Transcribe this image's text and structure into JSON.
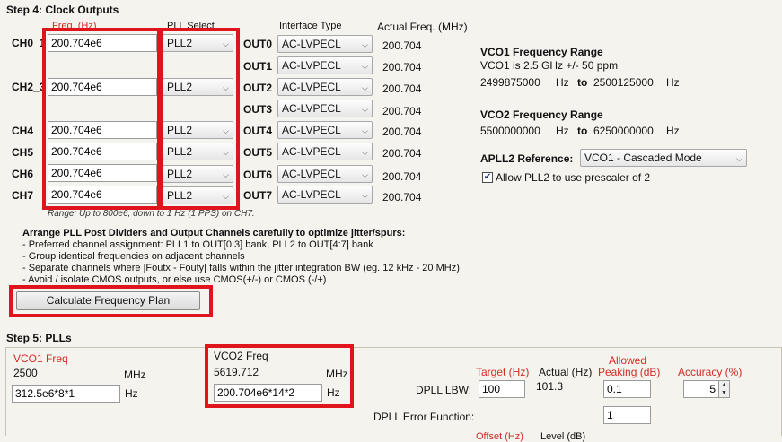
{
  "step4": {
    "title": "Step 4: Clock Outputs",
    "headers": {
      "freq": "Freq. (Hz)",
      "pll_select": "PLL Select",
      "interface_type": "Interface Type",
      "actual_freq": "Actual Freq. (MHz)"
    },
    "channels": [
      {
        "label": "CH0_1",
        "freq": "200.704e6",
        "pll": "PLL2"
      },
      {
        "label": "CH2_3",
        "freq": "200.704e6",
        "pll": "PLL2"
      },
      {
        "label": "CH4",
        "freq": "200.704e6",
        "pll": "PLL2"
      },
      {
        "label": "CH5",
        "freq": "200.704e6",
        "pll": "PLL2"
      },
      {
        "label": "CH6",
        "freq": "200.704e6",
        "pll": "PLL2"
      },
      {
        "label": "CH7",
        "freq": "200.704e6",
        "pll": "PLL2"
      }
    ],
    "outputs": [
      {
        "label": "OUT0",
        "interface": "AC-LVPECL",
        "actual": "200.704"
      },
      {
        "label": "OUT1",
        "interface": "AC-LVPECL",
        "actual": "200.704"
      },
      {
        "label": "OUT2",
        "interface": "AC-LVPECL",
        "actual": "200.704"
      },
      {
        "label": "OUT3",
        "interface": "AC-LVPECL",
        "actual": "200.704"
      },
      {
        "label": "OUT4",
        "interface": "AC-LVPECL",
        "actual": "200.704"
      },
      {
        "label": "OUT5",
        "interface": "AC-LVPECL",
        "actual": "200.704"
      },
      {
        "label": "OUT6",
        "interface": "AC-LVPECL",
        "actual": "200.704"
      },
      {
        "label": "OUT7",
        "interface": "AC-LVPECL",
        "actual": "200.704"
      }
    ],
    "range_note": "Range: Up to 800e6, down to 1 Hz (1 PPS) on CH7.",
    "advice_title": "Arrange PLL Post Dividers and Output Channels carefully to optimize jitter/spurs:",
    "advice": [
      "- Preferred channel assignment: PLL1 to OUT[0:3] bank, PLL2 to OUT[4:7] bank",
      "- Group identical frequencies on adjacent channels",
      "- Separate channels where |Foutx - Fouty| falls within the jitter integration BW (eg. 12 kHz - 20 MHz)",
      "- Avoid / isolate CMOS outputs, or else use CMOS(+/-) or CMOS (-/+)"
    ],
    "calc_button": "Calculate Frequency Plan",
    "vco1": {
      "title": "VCO1 Frequency Range",
      "desc": "VCO1 is 2.5 GHz +/- 50 ppm",
      "min": "2499875000",
      "max": "2500125000",
      "unit": "Hz",
      "to": "to"
    },
    "vco2": {
      "title": "VCO2 Frequency Range",
      "min": "5500000000",
      "max": "6250000000",
      "unit": "Hz",
      "to": "to"
    },
    "apll2": {
      "label": "APLL2 Reference:",
      "value": "VCO1 - Cascaded Mode",
      "checkbox_label": "Allow PLL2 to use prescaler of 2",
      "checked": true
    }
  },
  "step5": {
    "title": "Step 5: PLLs",
    "vco1_freq_label": "VCO1 Freq",
    "vco1_freq_value": "2500",
    "vco1_unit": "MHz",
    "vco1_input": "312.5e6*8*1",
    "vco1_input_unit": "Hz",
    "vco2_freq_label": "VCO2 Freq",
    "vco2_freq_value": "5619.712",
    "vco2_unit": "MHz",
    "vco2_input": "200.704e6*14*2",
    "vco2_input_unit": "Hz",
    "target_hdr": "Target (Hz)",
    "actual_hdr": "Actual (Hz)",
    "allowed_hdr": "Allowed",
    "peaking_hdr": "Peaking (dB)",
    "accuracy_hdr": "Accuracy (%)",
    "dpll_lbw_label": "DPLL LBW:",
    "dpll_lbw_target": "100",
    "dpll_lbw_actual": "101.3",
    "dpll_lbw_peaking": "0.1",
    "accuracy_value": "5",
    "dpll_err_label": "DPLL Error Function:",
    "dpll_err_value": "1",
    "offset_hdr": "Offset (Hz)",
    "level_hdr": "Level (dB)"
  },
  "colors": {
    "highlight": "#e0141c",
    "header_red": "#d12b24",
    "background": "#f5f3ee"
  }
}
